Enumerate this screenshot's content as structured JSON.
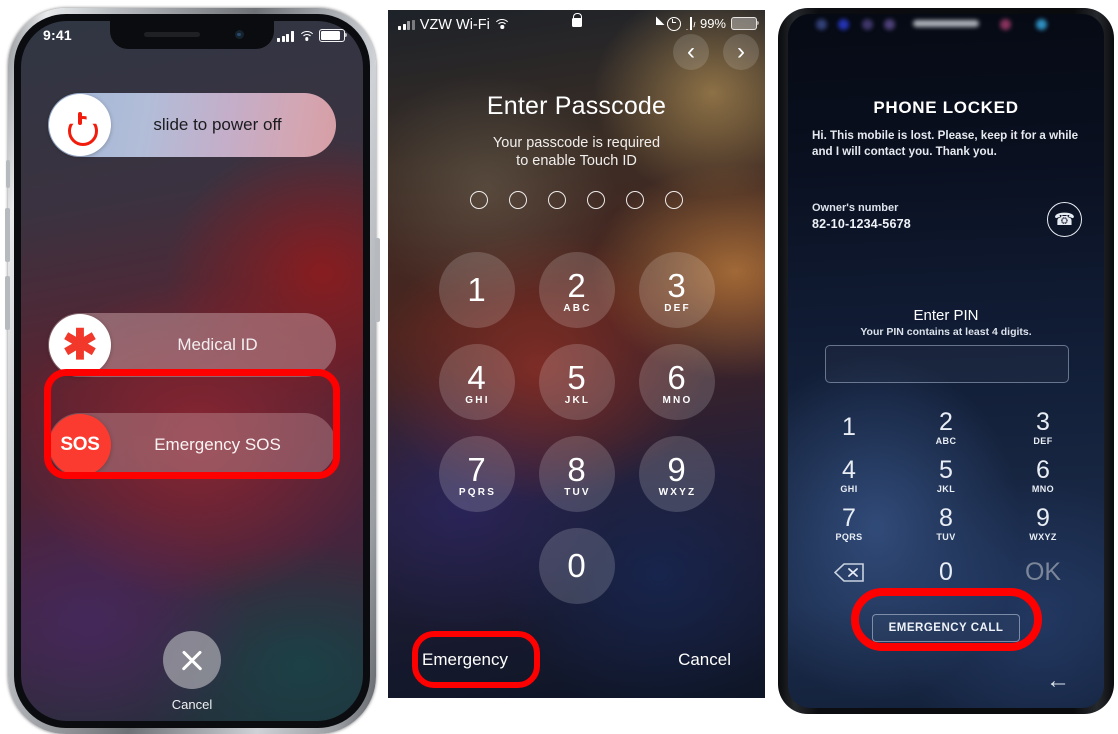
{
  "panels": [
    {
      "id": "iphone-power-off",
      "device": "iPhone X",
      "status_bar": {
        "time": "9:41",
        "icons": [
          "cellular-bars-icon",
          "wifi-icon",
          "battery-icon"
        ]
      },
      "power_slider": {
        "label": "slide to power off",
        "icon": "power-icon"
      },
      "medical_id": {
        "label": "Medical ID",
        "icon": "medical-asterisk-icon"
      },
      "emergency_sos": {
        "label": "Emergency SOS",
        "badge": "SOS",
        "highlighted": true
      },
      "cancel": {
        "label": "Cancel",
        "icon": "close-x-icon"
      }
    },
    {
      "id": "ios-enter-passcode",
      "status_bar": {
        "carrier": "VZW Wi-Fi",
        "battery_percent": "99%",
        "icons": [
          "cellular-bars-icon",
          "wifi-icon",
          "lock-icon",
          "location-arrow-icon",
          "alarm-icon",
          "bluetooth-icon",
          "battery-icon"
        ]
      },
      "nav": {
        "prev": "‹",
        "next": "›"
      },
      "title": "Enter Passcode",
      "subtitle_line1": "Your passcode is required",
      "subtitle_line2": "to enable Touch ID",
      "passcode_dots": 6,
      "keys": [
        {
          "num": "1",
          "letters": ""
        },
        {
          "num": "2",
          "letters": "ABC"
        },
        {
          "num": "3",
          "letters": "DEF"
        },
        {
          "num": "4",
          "letters": "GHI"
        },
        {
          "num": "5",
          "letters": "JKL"
        },
        {
          "num": "6",
          "letters": "MNO"
        },
        {
          "num": "7",
          "letters": "PQRS"
        },
        {
          "num": "8",
          "letters": "TUV"
        },
        {
          "num": "9",
          "letters": "WXYZ"
        },
        {
          "num": "0",
          "letters": ""
        }
      ],
      "emergency": {
        "label": "Emergency",
        "highlighted": true
      },
      "cancel": {
        "label": "Cancel"
      }
    },
    {
      "id": "android-phone-locked",
      "title": "PHONE LOCKED",
      "message": "Hi. This mobile is lost. Please, keep it for a while and I will contact you. Thank you.",
      "owner_label": "Owner's number",
      "owner_number": "82-10-1234-5678",
      "call_icon": "phone-handset-icon",
      "pin_title": "Enter PIN",
      "pin_subtitle": "Your PIN contains at least 4 digits.",
      "pin_value": "",
      "keys": [
        {
          "num": "1",
          "letters": ""
        },
        {
          "num": "2",
          "letters": "ABC"
        },
        {
          "num": "3",
          "letters": "DEF"
        },
        {
          "num": "4",
          "letters": "GHI"
        },
        {
          "num": "5",
          "letters": "JKL"
        },
        {
          "num": "6",
          "letters": "MNO"
        },
        {
          "num": "7",
          "letters": "PQRS"
        },
        {
          "num": "8",
          "letters": "TUV"
        },
        {
          "num": "9",
          "letters": "WXYZ"
        },
        {
          "num": "0",
          "letters": ""
        }
      ],
      "backspace_icon": "backspace-icon",
      "ok_label": "OK",
      "emergency_call": {
        "label": "EMERGENCY CALL",
        "highlighted": true
      },
      "back_icon": "back-arrow-icon"
    }
  ],
  "annotation": {
    "color": "#ff0000"
  }
}
